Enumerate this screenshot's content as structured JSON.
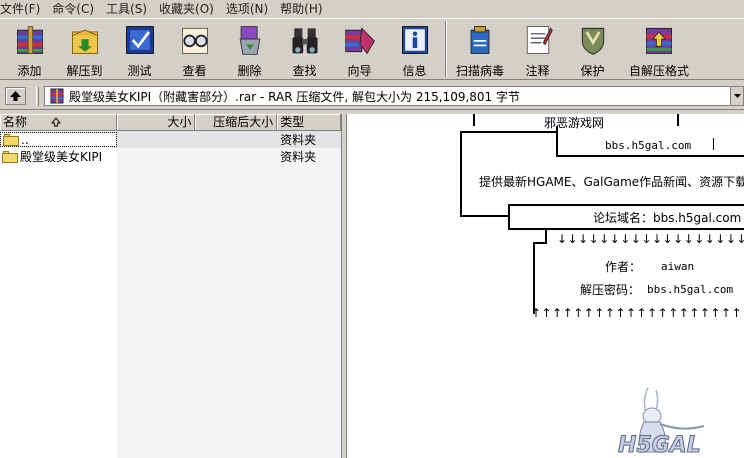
{
  "menu": [
    "文件(F)",
    "命令(C)",
    "工具(S)",
    "收藏夹(O)",
    "选项(N)",
    "帮助(H)"
  ],
  "toolbar": [
    {
      "label": "添加",
      "icon": "add-books-icon"
    },
    {
      "label": "解压到",
      "icon": "extract-folder-icon"
    },
    {
      "label": "测试",
      "icon": "test-check-icon"
    },
    {
      "label": "查看",
      "icon": "view-glasses-icon"
    },
    {
      "label": "删除",
      "icon": "delete-recycle-icon"
    },
    {
      "label": "查找",
      "icon": "find-binoculars-icon"
    },
    {
      "label": "向导",
      "icon": "wizard-icon"
    },
    {
      "label": "信息",
      "icon": "info-icon"
    },
    {
      "label": "扫描病毒",
      "icon": "virus-scan-icon"
    },
    {
      "label": "注释",
      "icon": "comment-icon"
    },
    {
      "label": "保护",
      "icon": "protect-shield-icon"
    },
    {
      "label": "自解压格式",
      "icon": "sfx-icon"
    }
  ],
  "address": {
    "path": "殿堂级美女KIPI（附藏害部分）.rar - RAR 压缩文件, 解包大小为 215,109,801 字节"
  },
  "columns": {
    "name": "名称",
    "size": "大小",
    "packed": "压缩后大小",
    "type": "类型"
  },
  "files": [
    {
      "name": "..",
      "type": "资料夹"
    },
    {
      "name": "殿堂级美女KIPI",
      "type": "资料夹"
    }
  ],
  "comment": {
    "site_name": "邪恶游戏网",
    "site_url": "bbs.h5gal.com",
    "tagline": "提供最新HGAME、GalGame作品新闻、资源下载的社",
    "forum_label": "论坛域名：bbs.h5gal.com",
    "author_label": "作者：",
    "author": "aiwan",
    "password_label": "解压密码：",
    "password": "bbs.h5gal.com",
    "arrows_down": "↓↓↓↓↓↓↓↓↓↓↓↓↓↓↓↓↓↓↓↓↓",
    "arrows_up": "↑↑↑↑↑↑↑↑↑↑↑↑↑↑↑↑↑↑↑↑↑",
    "logo_text": "H5GAL"
  },
  "colors": {
    "face": "#d4d0c8",
    "shadow": "#808080",
    "highlight": "#ffffff"
  }
}
